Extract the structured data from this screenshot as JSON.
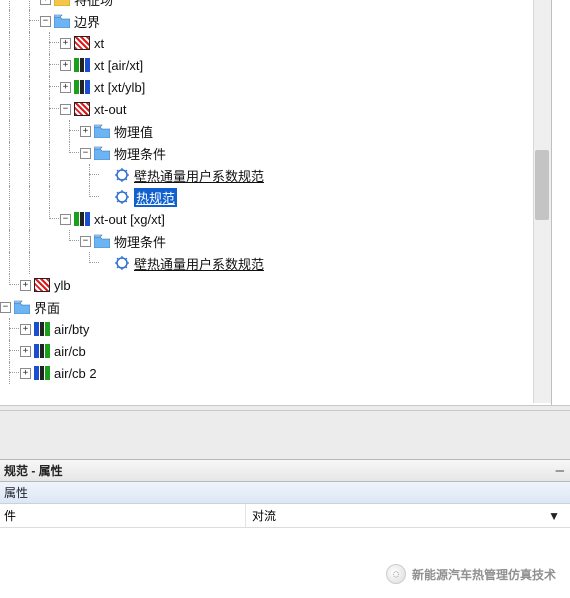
{
  "tree": {
    "top_cut": "特征场",
    "boundary": {
      "label": "边界"
    },
    "items": {
      "xt": "xt",
      "xt_air": "xt [air/xt]",
      "xt_ylb": "xt [xt/ylb]",
      "xt_out": "xt-out",
      "phys_value": "物理值",
      "phys_cond": "物理条件",
      "coeff_spec": "壁热通量用户系数规范",
      "heat_spec": "热规范",
      "xt_out_xg": "xt-out [xg/xt]",
      "phys_cond2": "物理条件",
      "coeff_spec2": "壁热通量用户系数规范",
      "ylb": "ylb",
      "interface": "界面",
      "air_bty": "air/bty",
      "air_cb": "air/cb",
      "air_cb2": "air/cb 2"
    }
  },
  "panel": {
    "title": "规范 - 属性",
    "section": "属性",
    "prop_key": "件",
    "prop_value": "对流"
  },
  "watermark": "新能源汽车热管理仿真技术",
  "glyphs": {
    "plus": "+",
    "minus": "−",
    "min_btn": "—",
    "chev": "▼",
    "wechat": "◌"
  }
}
